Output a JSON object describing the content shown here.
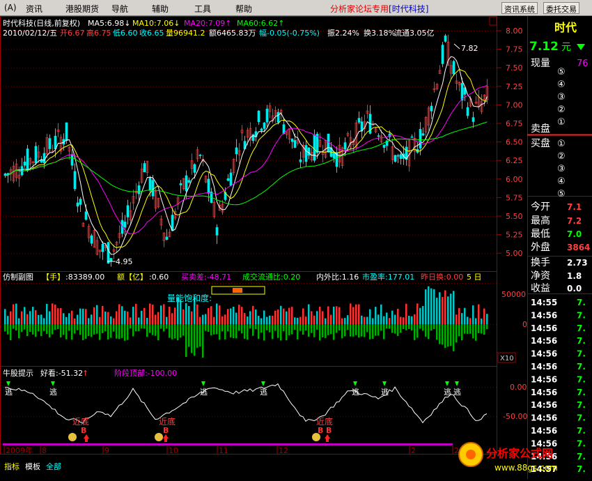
{
  "menu": {
    "items": [
      "(A)",
      "资讯",
      "港股期货",
      "导航",
      "辅助",
      "工具",
      "帮助"
    ],
    "brand_prefix": "分析家论坛专用",
    "brand_stock": "[时代科技]",
    "news_button": "资讯系统",
    "order_button": "委托交易"
  },
  "main_chart": {
    "title": "时代科技(日线,前复权)",
    "ma": [
      {
        "label": "MA5:6.98↓",
        "color": "#ffffff"
      },
      {
        "label": "MA10:7.06↓",
        "color": "#ffff00"
      },
      {
        "label": "MA20:7.09↑",
        "color": "#ff00ff"
      },
      {
        "label": "MA60:6.62↑",
        "color": "#00ff00"
      }
    ],
    "info_date": "2010/02/12/五",
    "info_open": "开6.67",
    "info_high": "高6.75",
    "info_low": "低6.60",
    "info_close": "收6.65",
    "info_volume": "量96941.2",
    "info_amount": "额6465.83万",
    "info_change": "幅-0.05(-0.75%)",
    "info_amplitude": "振2.24%",
    "info_turnover": "换3.18%",
    "info_float": "流通3.05亿",
    "y_ticks": [
      "8.00",
      "7.75",
      "7.50",
      "7.25",
      "7.00",
      "6.75",
      "6.50",
      "6.25",
      "6.00",
      "5.75",
      "5.50",
      "5.25",
      "5.00"
    ],
    "high_label": "7.82",
    "low_label": "4.95"
  },
  "volume_panel": {
    "title": "仿制副图",
    "hand_label": "【手】",
    "hand_value": ":83389.00",
    "amount_label": "额【亿】",
    "amount_value": ":0.60",
    "buysell": "买卖差:-48.71",
    "ratio": "成交流通比:0.20",
    "inout": "内外比:1.16",
    "pe": "市盈率:177.01",
    "prevturn": "昨日换:0.00",
    "days": "5 日",
    "saturation": "量能饱和度:",
    "y_ticks": [
      "50000",
      "0"
    ],
    "x10": "X10"
  },
  "indicator_panel": {
    "title": "牛股提示",
    "good": "好看:-51.32",
    "top": "阶段顶部:-100.00",
    "y_ticks": [
      "0.00",
      "-50.00"
    ],
    "escape": "逃",
    "near_bottom": "近底",
    "buy": "B"
  },
  "timeline": {
    "labels": [
      "2009年",
      "8",
      "9",
      "10",
      "11",
      "12",
      "2",
      "2"
    ]
  },
  "bottom_tabs": [
    "指标",
    "模板",
    "全部"
  ],
  "quote": {
    "name": "时代",
    "price": "7.12",
    "price_unit": "元",
    "vol_label": "现量",
    "vol_value": "76",
    "sell_label": "卖盘",
    "buy_label": "买盘",
    "sell_levels": [
      "⑤",
      "④",
      "③",
      "②",
      "①"
    ],
    "buy_levels": [
      "①",
      "②",
      "③",
      "④",
      "⑤"
    ],
    "stats": [
      {
        "label": "今开",
        "value": "7.1"
      },
      {
        "label": "最高",
        "value": "7.2"
      },
      {
        "label": "最低",
        "value": "7.0"
      },
      {
        "label": "外盘",
        "value": "3864"
      },
      {
        "label": "换手",
        "value": "2.73"
      },
      {
        "label": "净资",
        "value": "1.8"
      },
      {
        "label": "收益",
        "value": "0.0"
      }
    ],
    "ticks": [
      {
        "time": "14:55",
        "price": "7."
      },
      {
        "time": "14:56",
        "price": "7."
      },
      {
        "time": "14:56",
        "price": "7."
      },
      {
        "time": "14:56",
        "price": "7."
      },
      {
        "time": "14:56",
        "price": "7."
      },
      {
        "time": "14:56",
        "price": "7."
      },
      {
        "time": "14:56",
        "price": "7."
      },
      {
        "time": "14:56",
        "price": "7."
      },
      {
        "time": "14:56",
        "price": "7."
      },
      {
        "time": "14:56",
        "price": "7."
      },
      {
        "time": "14:56",
        "price": "7."
      },
      {
        "time": "14:56",
        "price": "7."
      },
      {
        "time": "14:56",
        "price": "7."
      },
      {
        "time": "14:57",
        "price": "7."
      }
    ]
  },
  "watermark": {
    "title": "分析家公式网",
    "url": "www.88gs.com"
  }
}
